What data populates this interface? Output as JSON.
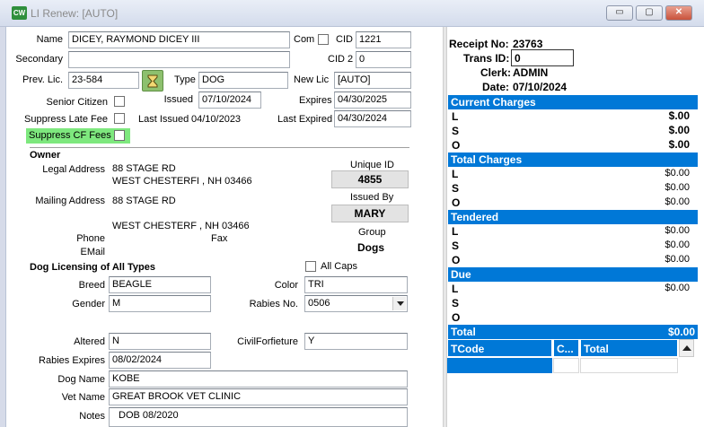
{
  "window": {
    "title": "LI Renew: [AUTO]",
    "app_icon_text": "CW",
    "minimize_symbol": "▭",
    "maximize_symbol": "▢",
    "close_symbol": "✕"
  },
  "license": {
    "name_label": "Name",
    "name_value": "DICEY, RAYMOND DICEY III",
    "com_label": "Com",
    "cid_label": "CID",
    "cid_value": "1221",
    "secondary_label": "Secondary",
    "secondary_value": "",
    "cid2_label": "CID 2",
    "cid2_value": "0",
    "prev_lic_label": "Prev. Lic.",
    "prev_lic_value": "23-584",
    "type_label": "Type",
    "type_value": "DOG",
    "new_lic_label": "New Lic",
    "new_lic_value": "[AUTO]",
    "senior_label": "Senior Citizen",
    "issued_label": "Issued",
    "issued_value": "07/10/2024",
    "expires_label": "Expires",
    "expires_value": "04/30/2025",
    "suppress_late_label": "Suppress Late Fee",
    "last_issued_label": "Last Issued",
    "last_issued_value": "04/10/2023",
    "last_expired_label": "Last Expired",
    "last_expired_value": "04/30/2024",
    "suppress_cf_label": "Suppress CF Fees"
  },
  "owner": {
    "header": "Owner",
    "legal_label": "Legal Address",
    "legal_line1": "88 STAGE RD",
    "legal_line2": "WEST CHESTERFI ,   NH    03466",
    "mailing_label": "Mailing Address",
    "mailing_line1": "88 STAGE RD",
    "mailing_line2": "WEST CHESTERF ,   NH    03466",
    "phone_label": "Phone",
    "fax_label": "Fax",
    "email_label": "EMail",
    "unique_id_label": "Unique ID",
    "unique_id_value": "4855",
    "issued_by_label": "Issued By",
    "issued_by_value": "MARY",
    "group_label": "Group",
    "group_value": "Dogs"
  },
  "dog": {
    "header": "Dog Licensing of All Types",
    "all_caps_label": "All Caps",
    "breed_label": "Breed",
    "breed_value": "BEAGLE",
    "color_label": "Color",
    "color_value": "TRI",
    "gender_label": "Gender",
    "gender_value": "M",
    "rabies_no_label": "Rabies No.",
    "rabies_no_value": "0506",
    "altered_label": "Altered",
    "altered_value": "N",
    "civil_label": "CivilForfieture",
    "civil_value": "Y",
    "rabies_exp_label": "Rabies Expires",
    "rabies_exp_value": "08/02/2024",
    "dog_name_label": "Dog Name",
    "dog_name_value": "KOBE",
    "vet_label": "Vet Name",
    "vet_value": "GREAT BROOK VET CLINIC",
    "notes_label": "Notes",
    "notes_value": "DOB 08/2020"
  },
  "receipt": {
    "receipt_no_label": "Receipt No:",
    "receipt_no_value": "23763",
    "trans_id_label": "Trans ID:",
    "trans_id_value": "0",
    "clerk_label": "Clerk:",
    "clerk_value": "ADMIN",
    "date_label": "Date:",
    "date_value": "07/10/2024",
    "sections": [
      {
        "title": "Current Charges",
        "rows": [
          {
            "key": "L",
            "amount": "$.00"
          },
          {
            "key": "S",
            "amount": "$.00"
          },
          {
            "key": "O",
            "amount": "$.00"
          }
        ]
      },
      {
        "title": "Total Charges",
        "rows": [
          {
            "key": "L",
            "amount": "$0.00"
          },
          {
            "key": "S",
            "amount": "$0.00"
          },
          {
            "key": "O",
            "amount": "$0.00"
          }
        ]
      },
      {
        "title": "Tendered",
        "rows": [
          {
            "key": "L",
            "amount": "$0.00"
          },
          {
            "key": "S",
            "amount": "$0.00"
          },
          {
            "key": "O",
            "amount": "$0.00"
          }
        ]
      },
      {
        "title": "Due",
        "rows": [
          {
            "key": "L",
            "amount": "$0.00"
          },
          {
            "key": "S",
            "amount": ""
          },
          {
            "key": "O",
            "amount": ""
          }
        ]
      }
    ],
    "total_label": "Total",
    "total_value": "$0.00",
    "grid_columns": [
      "TCode",
      "C...",
      "Total"
    ]
  },
  "colors": {
    "accent": "#0078d7",
    "highlight": "#7ee87e",
    "lookup_button": "#8dc06e"
  },
  "icons": {
    "lookup": "hourglass-icon"
  }
}
